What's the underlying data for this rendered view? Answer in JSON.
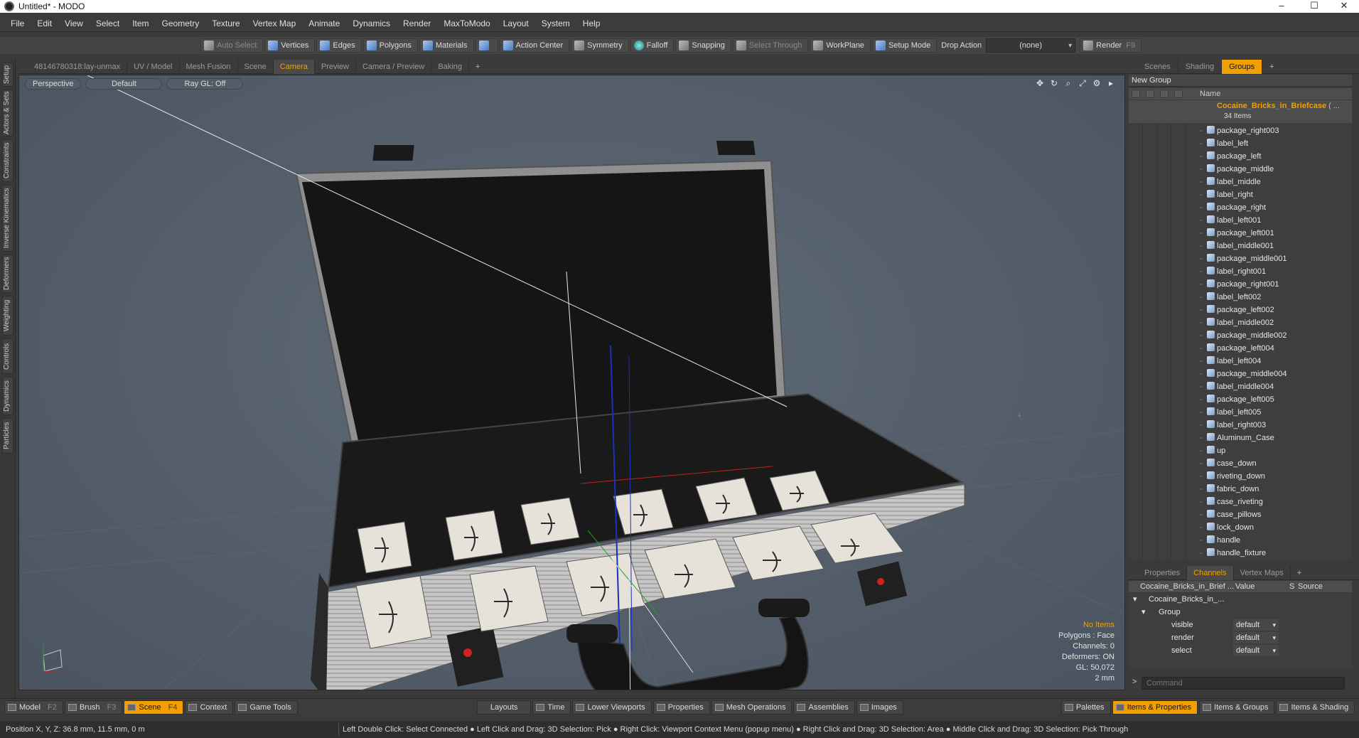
{
  "window": {
    "title": "Untitled* - MODO",
    "controls": [
      "–",
      "☐",
      "✕"
    ]
  },
  "menu": [
    "File",
    "Edit",
    "View",
    "Select",
    "Item",
    "Geometry",
    "Texture",
    "Vertex Map",
    "Animate",
    "Dynamics",
    "Render",
    "MaxToModo",
    "Layout",
    "System",
    "Help"
  ],
  "toolbar": {
    "auto_select": "Auto Select",
    "vertices": "Vertices",
    "edges": "Edges",
    "polygons": "Polygons",
    "materials": "Materials",
    "action_center": "Action Center",
    "symmetry": "Symmetry",
    "falloff": "Falloff",
    "snapping": "Snapping",
    "select_through": "Select Through",
    "workplane": "WorkPlane",
    "setup_mode": "Setup Mode",
    "drop_action": "Drop Action",
    "drop_value": "(none)",
    "render": "Render",
    "render_key": "F9"
  },
  "left_tabs": [
    "Setup",
    "Actors & Sets",
    "Constraints",
    "Inverse Kinematics",
    "Deformers",
    "Weighting",
    "Controls",
    "Dynamics",
    "Particles"
  ],
  "viewport_tabs": [
    "48146780318:lay-unmax",
    "UV / Model",
    "Mesh Fusion",
    "Scene",
    "Camera",
    "Preview",
    "Camera / Preview",
    "Baking",
    "+"
  ],
  "viewport_tab_active": "Camera",
  "viewport": {
    "view": "Perspective",
    "shading": "Default",
    "raygl": "Ray GL: Off",
    "info": {
      "items": "No Items",
      "polygons": "Polygons : Face",
      "channels": "Channels: 0",
      "deformers": "Deformers: ON",
      "gl": "GL: 50,072",
      "scale": "2 mm"
    }
  },
  "right_tabs": [
    "Scenes",
    "Shading",
    "Groups",
    "+"
  ],
  "right_tab_active": "Groups",
  "groups": {
    "new_group": "New Group",
    "name_header": "Name",
    "root": {
      "name": "Cocaine_Bricks_in_Briefcase",
      "suffix": "( ...",
      "count": "34 Items"
    },
    "items": [
      "package_right003",
      "label_left",
      "package_left",
      "package_middle",
      "label_middle",
      "label_right",
      "package_right",
      "label_left001",
      "package_left001",
      "label_middle001",
      "package_middle001",
      "label_right001",
      "package_right001",
      "label_left002",
      "package_left002",
      "label_middle002",
      "package_middle002",
      "package_left004",
      "label_left004",
      "package_middle004",
      "label_middle004",
      "package_left005",
      "label_left005",
      "label_right003",
      "Aluminum_Case",
      "up",
      "case_down",
      "riveting_down",
      "fabric_down",
      "case_riveting",
      "case_pillows",
      "lock_down",
      "handle",
      "handle_fixture"
    ]
  },
  "channels_tabs": [
    "Properties",
    "Channels",
    "Vertex Maps",
    "+"
  ],
  "channels_tab_active": "Channels",
  "channels": {
    "col_name": "Cocaine_Bricks_in_Brief ...",
    "col_value": "Value",
    "col_s": "S",
    "col_source": "Source",
    "root": "Cocaine_Bricks_in_...",
    "group": "Group",
    "rows": [
      {
        "name": "visible",
        "value": "default"
      },
      {
        "name": "render",
        "value": "default"
      },
      {
        "name": "select",
        "value": "default"
      }
    ]
  },
  "command": {
    "placeholder": "Command",
    "prompt": ">"
  },
  "bottom_left": [
    {
      "label": "Model",
      "key": "F2"
    },
    {
      "label": "Brush",
      "key": "F3"
    },
    {
      "label": "Scene",
      "key": "F4"
    },
    {
      "label": "Context",
      "key": ""
    },
    {
      "label": "Game Tools",
      "key": ""
    }
  ],
  "bottom_center": [
    "Layouts",
    "Time",
    "Lower Viewports",
    "Properties",
    "Mesh Operations",
    "Assemblies",
    "Images"
  ],
  "bottom_right": [
    "Palettes",
    "Items & Properties",
    "Items & Groups",
    "Items & Shading"
  ],
  "status": {
    "position": "Position X, Y, Z:   36.8 mm, 11.5 mm, 0 m",
    "hint": "Left Double Click: Select Connected ● Left Click and Drag: 3D Selection: Pick ● Right Click: Viewport Context Menu (popup menu) ● Right Click and Drag: 3D Selection: Area ● Middle Click and Drag: 3D Selection: Pick Through"
  },
  "colors": {
    "accent": "#f2a000",
    "viewport_bg": "#5a6470",
    "panel_bg": "#3e3e3e"
  }
}
